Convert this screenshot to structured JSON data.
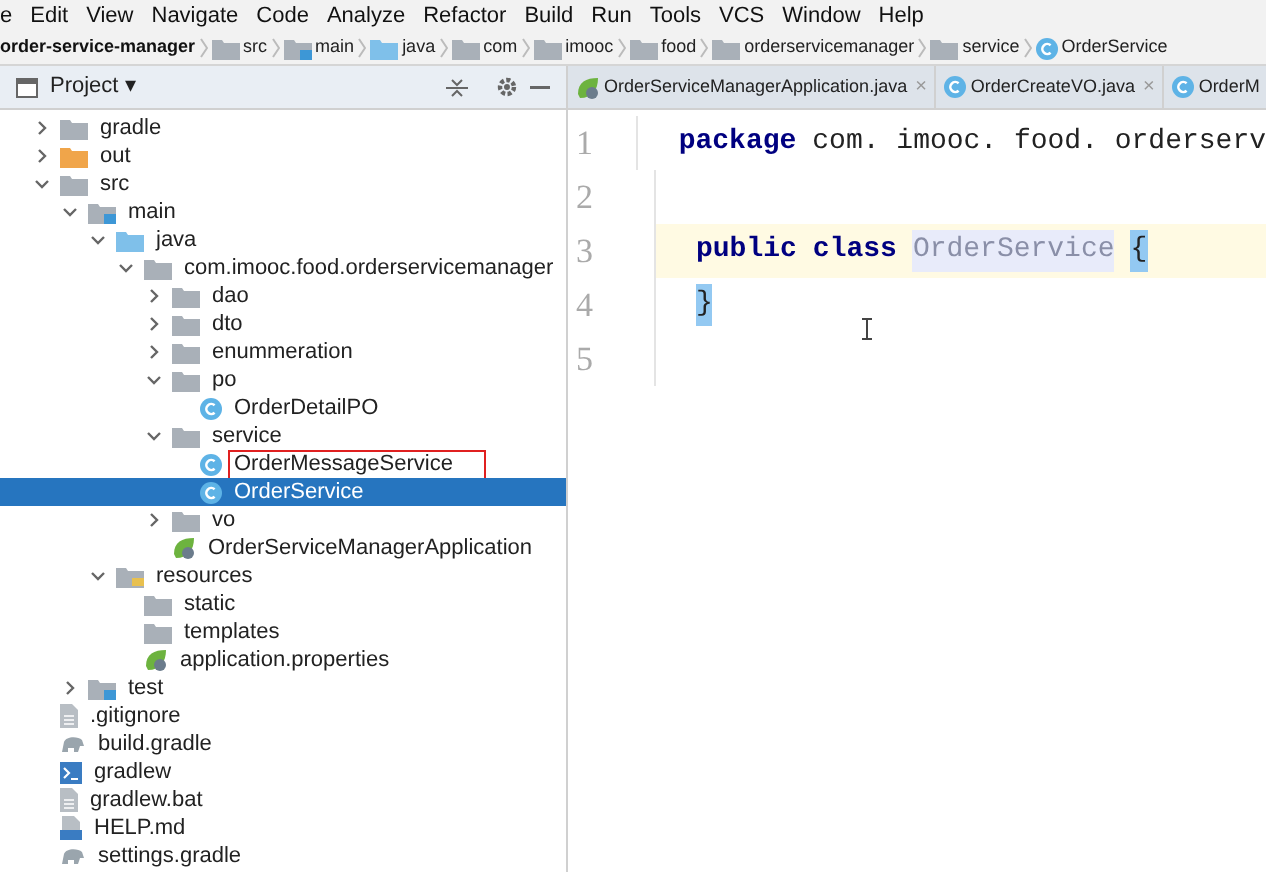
{
  "menu": [
    "e",
    "Edit",
    "View",
    "Navigate",
    "Code",
    "Analyze",
    "Refactor",
    "Build",
    "Run",
    "Tools",
    "VCS",
    "Window",
    "Help"
  ],
  "breadcrumbs": [
    {
      "label": "order-service-manager",
      "kind": "module"
    },
    {
      "label": "src",
      "kind": "folder"
    },
    {
      "label": "main",
      "kind": "source"
    },
    {
      "label": "java",
      "kind": "java"
    },
    {
      "label": "com",
      "kind": "folder"
    },
    {
      "label": "imooc",
      "kind": "folder"
    },
    {
      "label": "food",
      "kind": "folder"
    },
    {
      "label": "orderservicemanager",
      "kind": "folder"
    },
    {
      "label": "service",
      "kind": "folder"
    },
    {
      "label": "OrderService",
      "kind": "class"
    }
  ],
  "project_panel": {
    "title": "Project ▾"
  },
  "tree": [
    {
      "label": "gradle",
      "kind": "folder",
      "expanded": false,
      "selected": false,
      "outlined": false
    },
    {
      "label": "out",
      "kind": "output",
      "expanded": false,
      "selected": false,
      "outlined": false
    },
    {
      "label": "src",
      "kind": "folder",
      "expanded": true,
      "selected": false,
      "outlined": false,
      "children": [
        {
          "label": "main",
          "kind": "source",
          "expanded": true,
          "selected": false,
          "outlined": false,
          "children": [
            {
              "label": "java",
              "kind": "java",
              "expanded": true,
              "selected": false,
              "outlined": false,
              "children": [
                {
                  "label": "com.imooc.food.orderservicemanager",
                  "kind": "folder",
                  "expanded": true,
                  "selected": false,
                  "outlined": false,
                  "children": [
                    {
                      "label": "dao",
                      "kind": "folder",
                      "expanded": false,
                      "selected": false,
                      "outlined": false
                    },
                    {
                      "label": "dto",
                      "kind": "folder",
                      "expanded": false,
                      "selected": false,
                      "outlined": false
                    },
                    {
                      "label": "enummeration",
                      "kind": "folder",
                      "expanded": false,
                      "selected": false,
                      "outlined": false
                    },
                    {
                      "label": "po",
                      "kind": "folder",
                      "expanded": true,
                      "selected": false,
                      "outlined": false,
                      "children": [
                        {
                          "label": "OrderDetailPO",
                          "kind": "class",
                          "selected": false,
                          "outlined": false
                        }
                      ]
                    },
                    {
                      "label": "service",
                      "kind": "folder",
                      "expanded": true,
                      "selected": false,
                      "outlined": false,
                      "children": [
                        {
                          "label": "OrderMessageService",
                          "kind": "class",
                          "selected": false,
                          "outlined": true
                        },
                        {
                          "label": "OrderService",
                          "kind": "class",
                          "selected": true,
                          "outlined": false
                        }
                      ]
                    },
                    {
                      "label": "vo",
                      "kind": "folder",
                      "expanded": false,
                      "selected": false,
                      "outlined": false
                    },
                    {
                      "label": "OrderServiceManagerApplication",
                      "kind": "spring",
                      "selected": false,
                      "outlined": false
                    }
                  ]
                }
              ]
            },
            {
              "label": "resources",
              "kind": "resources",
              "expanded": true,
              "selected": false,
              "outlined": false,
              "children": [
                {
                  "label": "static",
                  "kind": "folder",
                  "selected": false,
                  "outlined": false
                },
                {
                  "label": "templates",
                  "kind": "folder",
                  "selected": false,
                  "outlined": false
                },
                {
                  "label": "application.properties",
                  "kind": "spring",
                  "selected": false,
                  "outlined": false
                }
              ]
            }
          ]
        },
        {
          "label": "test",
          "kind": "source",
          "expanded": false,
          "selected": false,
          "outlined": false
        }
      ]
    },
    {
      "label": ".gitignore",
      "kind": "file",
      "selected": false,
      "outlined": false
    },
    {
      "label": "build.gradle",
      "kind": "gradle",
      "selected": false,
      "outlined": false
    },
    {
      "label": "gradlew",
      "kind": "shell",
      "selected": false,
      "outlined": false
    },
    {
      "label": "gradlew.bat",
      "kind": "file",
      "selected": false,
      "outlined": false
    },
    {
      "label": "HELP.md",
      "kind": "markdown",
      "selected": false,
      "outlined": false
    },
    {
      "label": "settings.gradle",
      "kind": "gradle",
      "selected": false,
      "outlined": false
    }
  ],
  "editor_tabs": [
    {
      "label": "OrderServiceManagerApplication.java",
      "kind": "spring",
      "close": "×"
    },
    {
      "label": "OrderCreateVO.java",
      "kind": "class",
      "close": "×"
    },
    {
      "label": "OrderM",
      "kind": "class"
    }
  ],
  "code": [
    {
      "number": "1",
      "current": false,
      "tokens": [
        {
          "text": "package",
          "kind": "keyword"
        },
        {
          "text": "com. imooc. food. orderserv",
          "kind": "plain"
        }
      ]
    },
    {
      "number": "2",
      "current": false
    },
    {
      "number": "3",
      "current": true,
      "tokens": [
        {
          "text": "public",
          "kind": "keyword"
        },
        {
          "text": "class",
          "kind": "keyword"
        },
        {
          "text": "OrderService",
          "kind": "usage"
        },
        {
          "text": "{",
          "kind": "brace"
        }
      ]
    },
    {
      "number": "4",
      "current": false,
      "tokens": [
        {
          "text": "}",
          "kind": "brace"
        }
      ]
    },
    {
      "number": "5",
      "current": false
    }
  ]
}
